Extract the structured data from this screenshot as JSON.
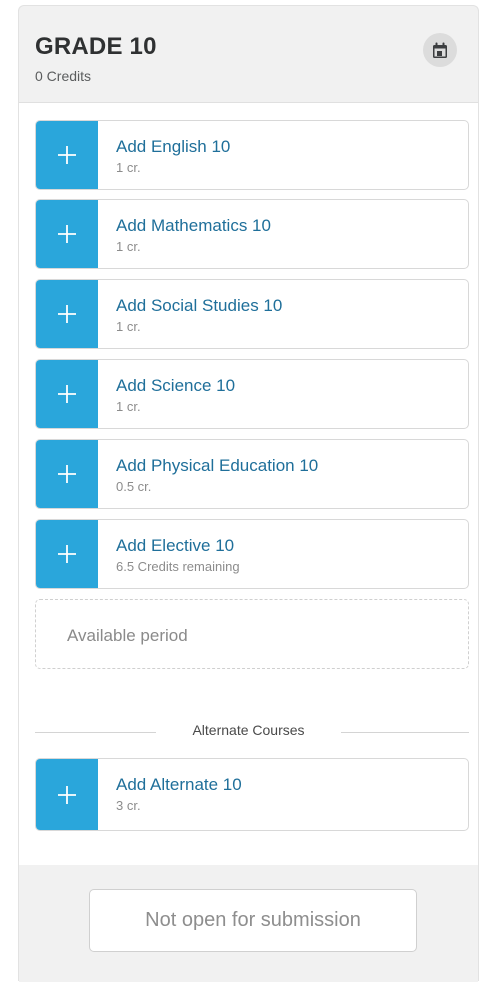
{
  "grade": {
    "title": "GRADE 10",
    "credits": "0 Credits"
  },
  "icons": {
    "calendar": "calendar-icon",
    "add": "plus-icon"
  },
  "colors": {
    "accent": "#2aa6db",
    "link": "#1f6f9a"
  },
  "courses": [
    {
      "title": "Add English 10",
      "sub": "1 cr."
    },
    {
      "title": "Add Mathematics 10",
      "sub": "1 cr."
    },
    {
      "title": "Add Social Studies 10",
      "sub": "1 cr."
    },
    {
      "title": "Add Science 10",
      "sub": "1 cr."
    },
    {
      "title": "Add Physical Education 10",
      "sub": "0.5 cr."
    },
    {
      "title": "Add Elective 10",
      "sub": "6.5 Credits remaining"
    }
  ],
  "available_period": "Available period",
  "alternate": {
    "section_label": "Alternate Courses",
    "title": "Add Alternate 10",
    "sub": "3 cr."
  },
  "footer": {
    "submit_label": "Not open for submission"
  }
}
